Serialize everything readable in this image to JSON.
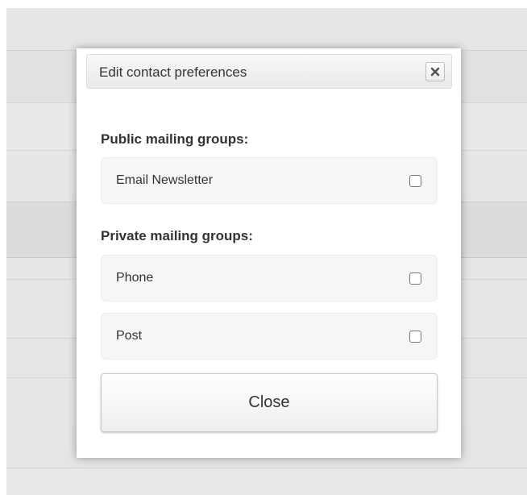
{
  "modal": {
    "title": "Edit contact preferences",
    "close_icon": "close-icon",
    "public_groups_label": "Public mailing groups:",
    "private_groups_label": "Private mailing groups:",
    "public_options": [
      {
        "label": "Email Newsletter",
        "checked": false
      }
    ],
    "private_options": [
      {
        "label": "Phone",
        "checked": false
      },
      {
        "label": "Post",
        "checked": false
      }
    ],
    "close_button_label": "Close"
  },
  "colors": {
    "overlay_background": "#e5e5e5",
    "modal_background": "#ffffff",
    "option_background": "#f6f6f6",
    "text": "#333333"
  }
}
